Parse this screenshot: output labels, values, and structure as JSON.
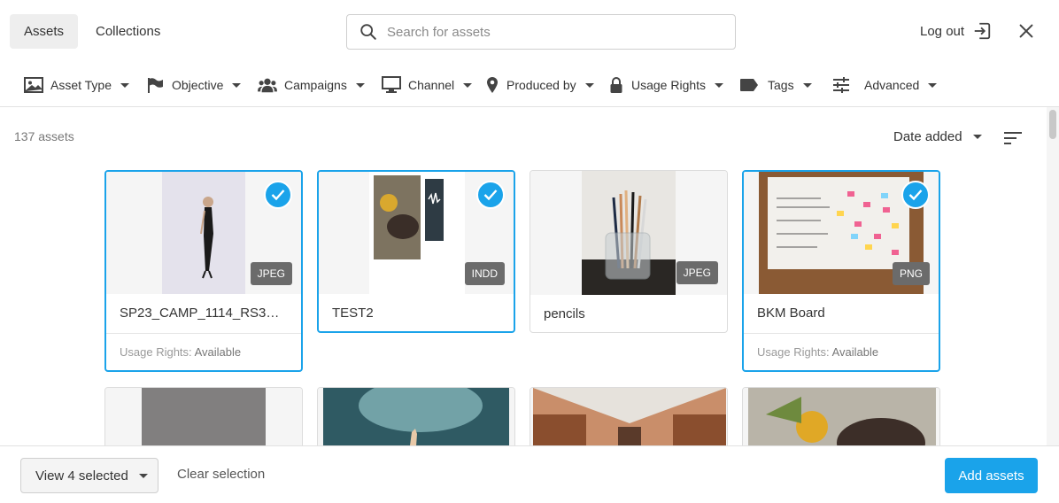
{
  "header": {
    "tabs": [
      {
        "label": "Assets",
        "active": true
      },
      {
        "label": "Collections",
        "active": false
      }
    ],
    "search": {
      "placeholder": "Search for assets",
      "value": "",
      "icon": "search-icon"
    },
    "logout_label": "Log out",
    "close_icon": "close-icon"
  },
  "filters": [
    {
      "label": "Asset Type",
      "icon": "image-icon"
    },
    {
      "label": "Objective",
      "icon": "flag-icon"
    },
    {
      "label": "Campaigns",
      "icon": "users-icon"
    },
    {
      "label": "Channel",
      "icon": "monitor-icon"
    },
    {
      "label": "Produced by",
      "icon": "location-pin-icon"
    },
    {
      "label": "Usage Rights",
      "icon": "lock-icon"
    },
    {
      "label": "Tags",
      "icon": "tag-icon"
    },
    {
      "label": "Advanced",
      "icon": "sliders-icon"
    }
  ],
  "toolbar": {
    "count": "137 assets",
    "sort_label": "Date added",
    "sort_icon": "sort-order-icon"
  },
  "assets": [
    {
      "name": "SP23_CAMP_1114_RS3D0...",
      "type": "JPEG",
      "selected": true,
      "rights_label": "Usage Rights:",
      "rights_value": "Available"
    },
    {
      "name": "TEST2",
      "type": "INDD",
      "selected": true
    },
    {
      "name": "pencils",
      "type": "JPEG",
      "selected": false
    },
    {
      "name": "BKM Board",
      "type": "PNG",
      "selected": true,
      "rights_label": "Usage Rights:",
      "rights_value": "Available"
    }
  ],
  "footer": {
    "view_selected_label": "View 4 selected",
    "clear_label": "Clear selection",
    "add_label": "Add assets"
  },
  "colors": {
    "accent": "#1aa3ea",
    "badge": "#6b6b6b"
  }
}
